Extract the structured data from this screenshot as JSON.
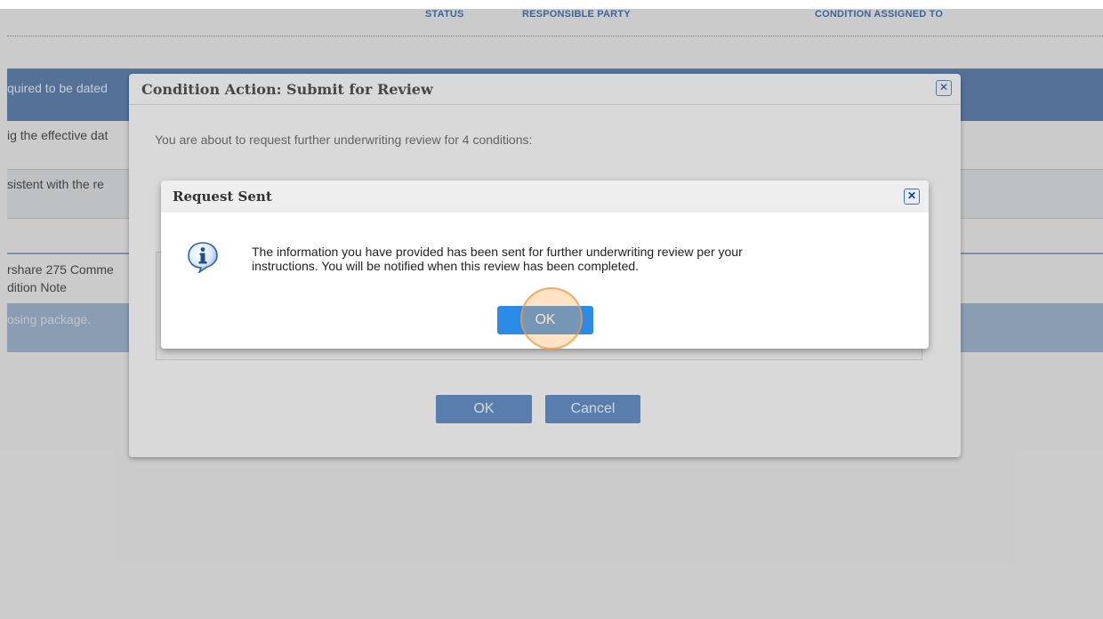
{
  "columns": {
    "status": "STATUS",
    "responsible_party": "RESPONSIBLE PARTY",
    "condition_assigned_to": "CONDITION ASSIGNED TO"
  },
  "background_rows": [
    "quired to be dated",
    "ig the effective dat",
    "sistent with the re",
    "rshare 275 Comme",
    "dition Note",
    "osing package."
  ],
  "outer_dialog": {
    "title": "Condition Action: Submit for Review",
    "close_glyph": "✕",
    "message": "You are about to request further underwriting review for 4 conditions:",
    "ok_label": "OK",
    "cancel_label": "Cancel"
  },
  "inner_dialog": {
    "title": "Request Sent",
    "close_glyph": "✕",
    "icon": "info-icon",
    "message_line1": "The information you have provided has been sent for further underwriting review per your",
    "message_line2": "instructions. You will be notified when this review has been completed.",
    "ok_label": "OK"
  },
  "colors": {
    "accent": "#2b8be6",
    "header_text": "#2d67b1",
    "highlight": "#f4963c"
  }
}
